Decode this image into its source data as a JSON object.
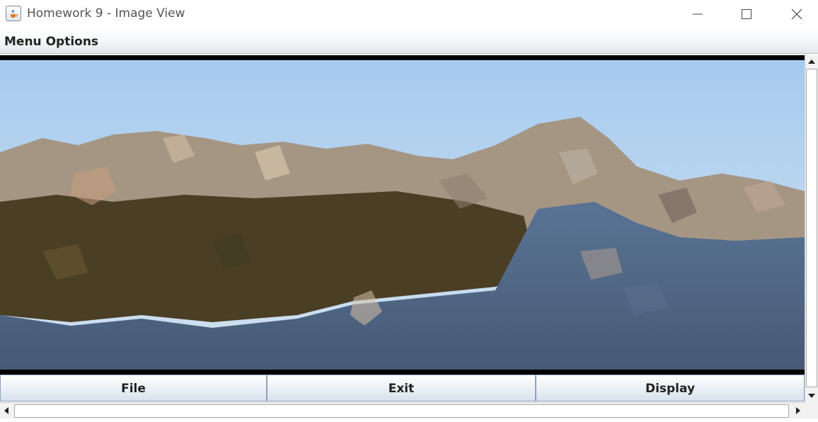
{
  "window": {
    "title": "Homework 9 - Image View",
    "app_icon": "java-cup-icon",
    "controls": [
      "minimize-icon",
      "maximize-icon",
      "close-icon"
    ]
  },
  "menu": {
    "label": "Menu Options"
  },
  "image": {
    "subject": "mosaic-landscape",
    "colors": {
      "sky": "#b5d3ef",
      "cliffs": "#a99b8a",
      "forest": "#4b3f25",
      "water": "#4f6784"
    }
  },
  "buttons": {
    "file": "File",
    "exit": "Exit",
    "display": "Display"
  },
  "scrollbars": {
    "vertical": [
      "scroll-up-icon",
      "scroll-down-icon"
    ],
    "horizontal": [
      "scroll-left-icon",
      "scroll-right-icon"
    ]
  }
}
